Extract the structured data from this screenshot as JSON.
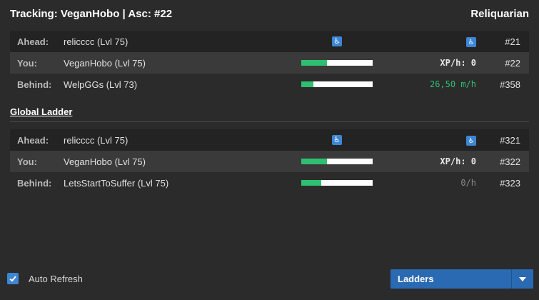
{
  "header": {
    "title": "Tracking: VeganHobo | Asc: #22",
    "league": "Reliquarian"
  },
  "character_ladder": {
    "rows": [
      {
        "role": "Ahead:",
        "name": "relicccc (Lvl 75)",
        "progress": null,
        "rate": "",
        "rank": "#21"
      },
      {
        "role": "You:",
        "name": "VeganHobo (Lvl 75)",
        "progress": 0.36,
        "rate": "XP/h: 0",
        "rank": "#22"
      },
      {
        "role": "Behind:",
        "name": "WelpGGs (Lvl 73)",
        "progress": 0.17,
        "rate": "26,50 m/h",
        "rank": "#358"
      }
    ]
  },
  "global_ladder": {
    "title": "Global Ladder",
    "rows": [
      {
        "role": "Ahead:",
        "name": "relicccc (Lvl 75)",
        "progress": null,
        "rate": "",
        "rank": "#321"
      },
      {
        "role": "You:",
        "name": "VeganHobo (Lvl 75)",
        "progress": 0.36,
        "rate": "XP/h: 0",
        "rank": "#322"
      },
      {
        "role": "Behind:",
        "name": "LetsStartToSuffer (Lvl 75)",
        "progress": 0.28,
        "rate": "0/h",
        "rank": "#323"
      }
    ]
  },
  "footer": {
    "auto_refresh_label": "Auto Refresh",
    "auto_refresh_checked": true,
    "ladders_button": "Ladders"
  },
  "icons": {
    "placeholder_icon": "wheelchair-icon",
    "accent": "#3d86d6",
    "progress_color": "#2fbf71"
  }
}
